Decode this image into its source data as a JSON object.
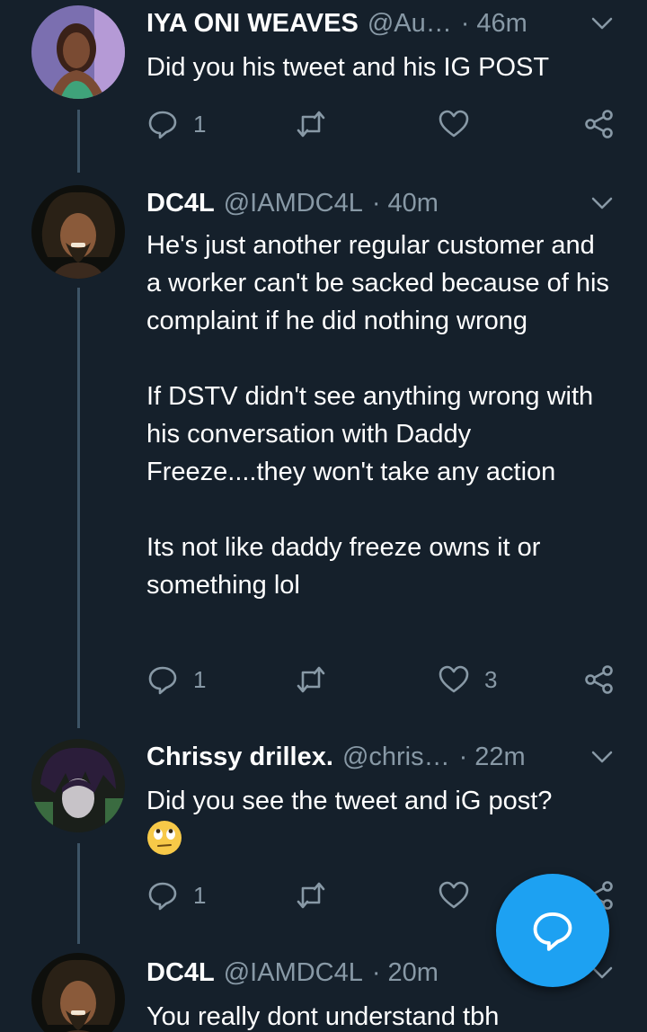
{
  "tweets": [
    {
      "name": "IYA ONI WEAVES",
      "handle": "@Au…",
      "time": "46m",
      "text": "Did you his tweet and his IG POST",
      "replies": "1",
      "retweets": "",
      "likes": ""
    },
    {
      "name": "DC4L",
      "handle": "@IAMDC4L",
      "time": "40m",
      "text": "He's just another regular customer and a worker can't be sacked because of his complaint if he did nothing wrong\n\nIf DSTV didn't see anything wrong with his conversation with Daddy Freeze....they won't take any action\n\nIts not like daddy freeze owns it or something lol",
      "replies": "1",
      "retweets": "",
      "likes": "3"
    },
    {
      "name": "Chrissy drillex.",
      "handle": "@chris…",
      "time": "22m",
      "text": "Did you see the tweet and iG post?",
      "emoji": "face-with-rolling-eyes",
      "replies": "1",
      "retweets": "",
      "likes": ""
    },
    {
      "name": "DC4L",
      "handle": "@IAMDC4L",
      "time": "20m",
      "text": "You really dont understand tbh"
    }
  ],
  "fab": {
    "icon": "compose-reply-icon",
    "color": "#1da1f2"
  },
  "colors": {
    "background": "#15202b",
    "secondary_text": "#8899a6",
    "thread_line": "#3d5466"
  }
}
